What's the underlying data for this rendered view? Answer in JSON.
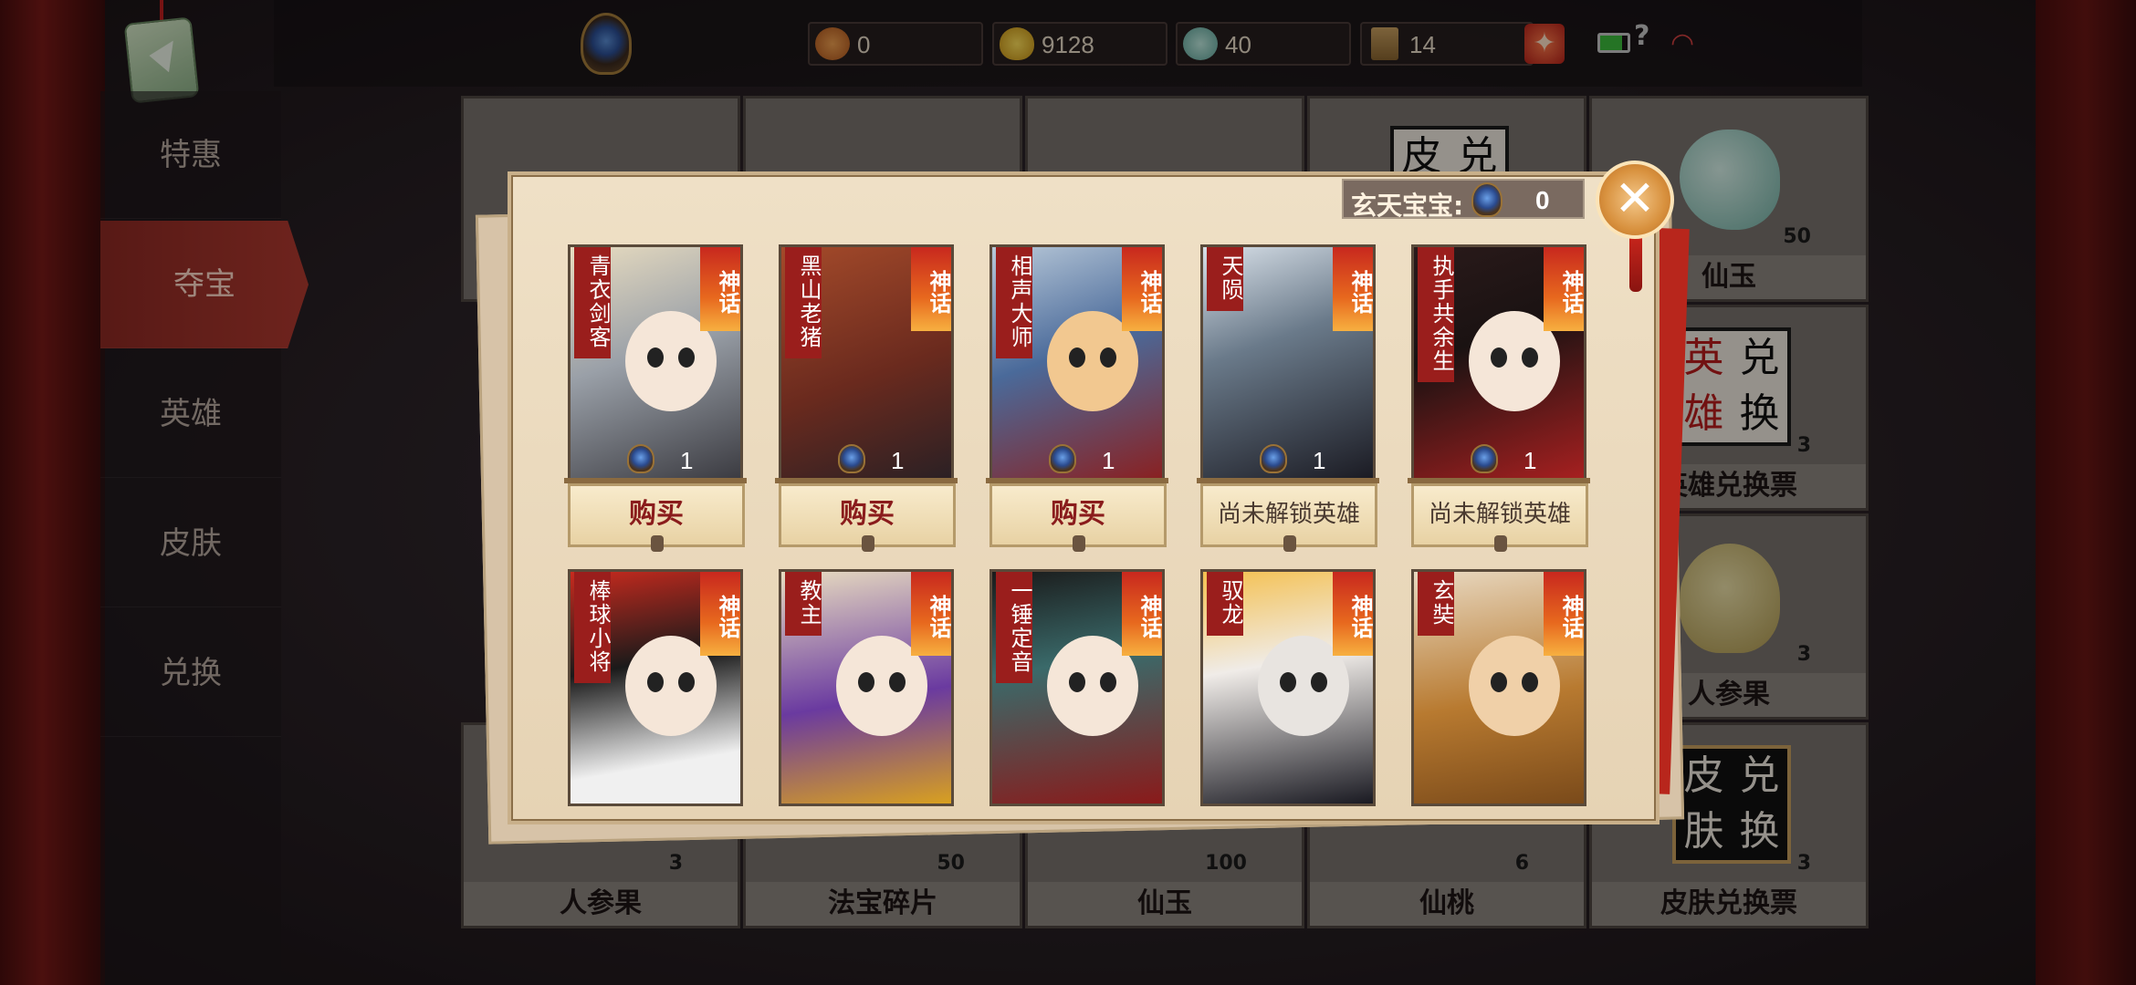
{
  "resources": [
    {
      "icon": "copper-coin-icon",
      "value": "0"
    },
    {
      "icon": "gold-ingot-icon",
      "value": "9128"
    },
    {
      "icon": "jade-icon",
      "value": "40"
    },
    {
      "icon": "gate-ticket-icon",
      "value": "14"
    }
  ],
  "plus_label": "✦",
  "sidebar": {
    "items": [
      {
        "label": "特惠",
        "active": false
      },
      {
        "label": "夺宝",
        "active": true
      },
      {
        "label": "英雄",
        "active": false
      },
      {
        "label": "皮肤",
        "active": false
      },
      {
        "label": "兑换",
        "active": false
      }
    ]
  },
  "shop_grid": {
    "cells": [
      {
        "name": "",
        "count": ""
      },
      {
        "name": "",
        "count": ""
      },
      {
        "name": "",
        "count": ""
      },
      {
        "name": "",
        "count": ""
      },
      {
        "name": "仙玉",
        "count": "50"
      },
      {
        "name": "英雄兑换票",
        "count": "3",
        "stamp": [
          "英",
          "兑",
          "雄",
          "换"
        ]
      },
      {
        "name": "人参果",
        "count": "3"
      },
      {
        "name": "人参果",
        "count": "3"
      },
      {
        "name": "法宝碎片",
        "count": "50"
      },
      {
        "name": "仙玉",
        "count": "100"
      },
      {
        "name": "仙桃",
        "count": "6"
      },
      {
        "name": "皮肤兑换票",
        "count": "3",
        "stamp": [
          "皮",
          "兑",
          "肤",
          "换"
        ]
      }
    ],
    "top_stamp": [
      "皮",
      "兑"
    ]
  },
  "modal": {
    "currency_label": "玄天宝宝:",
    "currency_value": "0",
    "close_label": "✕",
    "cards": [
      {
        "name": "青衣剑客",
        "tier": "神话",
        "qty": "1",
        "button": "购买"
      },
      {
        "name": "黑山老猪",
        "tier": "神话",
        "qty": "1",
        "button": "购买"
      },
      {
        "name": "相声大师",
        "tier": "神话",
        "qty": "1",
        "button": "购买"
      },
      {
        "name": "天陨",
        "tier": "神话",
        "qty": "1",
        "button": "尚未解锁英雄"
      },
      {
        "name": "执手共余生",
        "tier": "神话",
        "qty": "1",
        "button": "尚未解锁英雄"
      },
      {
        "name": "棒球小将",
        "tier": "神话",
        "qty": "",
        "button": ""
      },
      {
        "name": "教主",
        "tier": "神话",
        "qty": "",
        "button": ""
      },
      {
        "name": "一锤定音",
        "tier": "神话",
        "qty": "",
        "button": ""
      },
      {
        "name": "驭龙",
        "tier": "神话",
        "qty": "",
        "button": ""
      },
      {
        "name": "玄奘",
        "tier": "神话",
        "qty": "",
        "button": ""
      }
    ]
  },
  "colors": {
    "accent_red": "#9a1e1c",
    "tier_orange": "#e7681e",
    "paper": "#efe0c6"
  }
}
